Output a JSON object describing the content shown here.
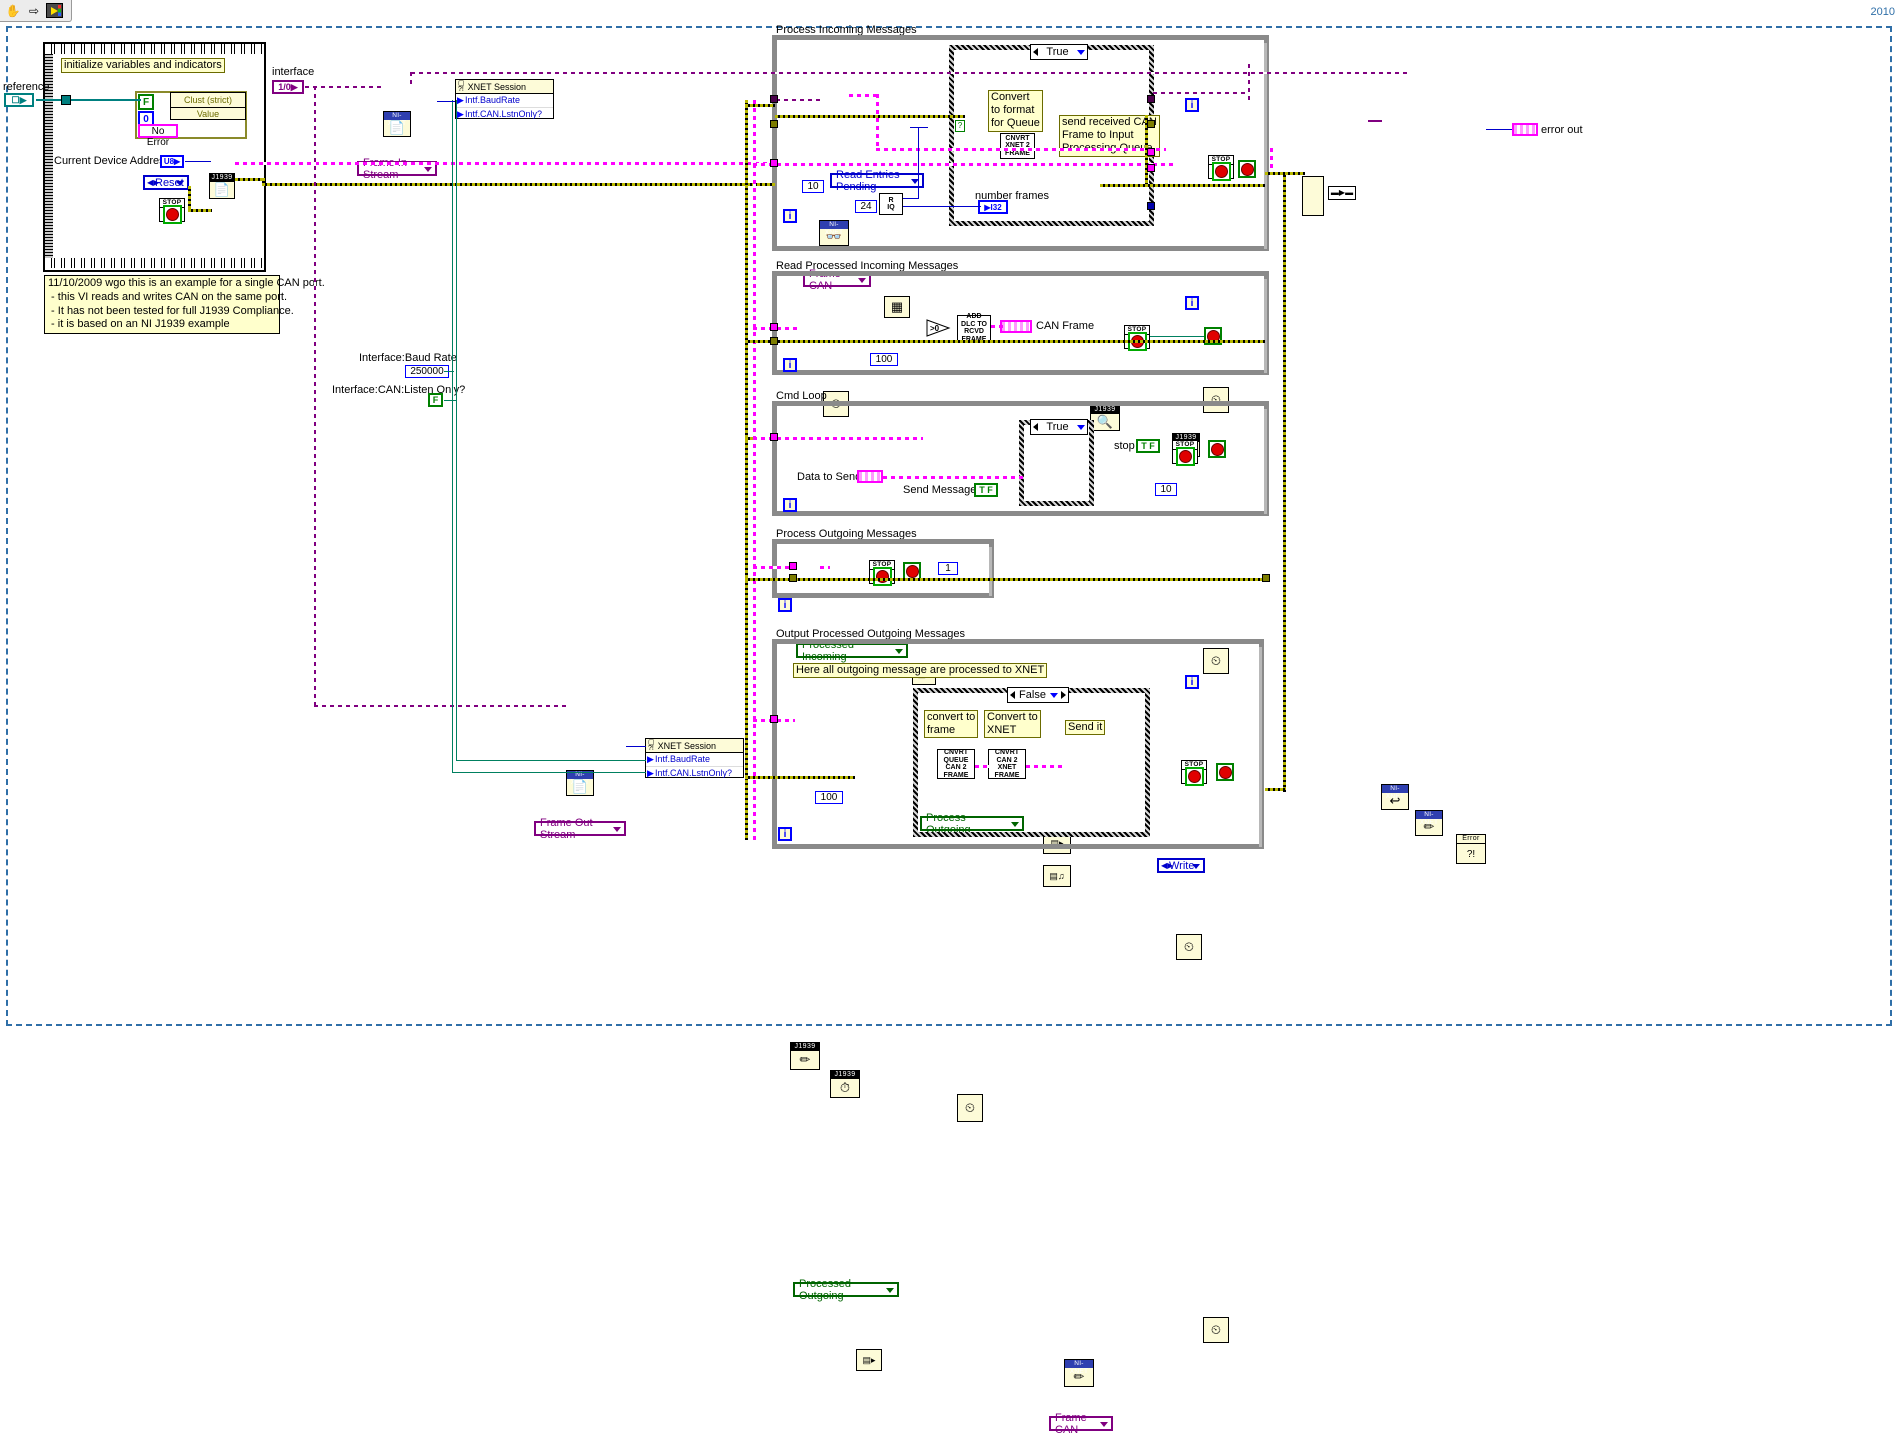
{
  "window": {
    "version_label": "2010",
    "toolbar": {
      "items": [
        {
          "name": "hand-tool-icon",
          "glyph": "✋"
        },
        {
          "name": "arrow-right-icon",
          "glyph": "⇨"
        },
        {
          "name": "run-vi-icon",
          "glyph": ""
        }
      ]
    }
  },
  "top_left": {
    "reference_label": "reference",
    "init_comment": "initialize variables and indicators",
    "cluster_vi": {
      "line1": "Clust (strict)",
      "line2": "Value"
    },
    "bool_f": "F",
    "number_zero": "0",
    "error_label": "No Error",
    "device_address_label": "Current Device Address",
    "device_address_type": "U8",
    "reset_enum": "Reset",
    "stop_label": "STOP",
    "j1939_label": "J1939",
    "note_comment": "11/10/2009 wgo this is an example for a single CAN port.\n - this VI reads and writes CAN on the same port.\n - It has not been tested for full J1939 Compliance.\n - it is based on an NI J1939 example"
  },
  "interface_section": {
    "interface_label": "interface",
    "interface_value": "1/0",
    "frame_in_stream": "Frame In Stream",
    "frame_out_stream": "Frame Out Stream",
    "nixnet_tag": "NI-XNET",
    "xnet_session_in": {
      "title": "XNET Session",
      "props": [
        "Intf.BaudRate",
        "Intf.CAN.LstnOnly?"
      ]
    },
    "xnet_session_out": {
      "title": "XNET Session",
      "props": [
        "Intf.BaudRate",
        "Intf.CAN.LstnOnly?"
      ]
    },
    "baud_rate_label": "Interface:Baud Rate",
    "baud_rate_value": "250000",
    "listen_only_label": "Interface:CAN:Listen Only?",
    "listen_only_value": "F"
  },
  "sections": [
    {
      "id": "process-incoming-messages",
      "title": "Process Incoming Messages",
      "read_entries_enum": "Read Entries Pending",
      "frame_can_enum": "Frame CAN",
      "nixnet_tag": "NI-XNET",
      "case_value": "True",
      "comment_convert": "Convert\nto format\nfor Queue",
      "comment_send": "send received CAN\nFrame to Input\nProcessing Queue",
      "cnvrt_vi": "CNVRT\nXNET 2\nFRAME",
      "number_frames_label": "number frames",
      "number_frames_type": "I32",
      "wait_value": "10",
      "divisor_value": "24",
      "greater_than": ">0",
      "loop_index": "i",
      "stop_label": "STOP",
      "j1939_tag": "J1939",
      "quotient_vi": "R\nIQ"
    },
    {
      "id": "read-processed-incoming-messages",
      "title": "Read Processed Incoming Messages",
      "queue_name": "Processed Incoming",
      "timeout_value": "100",
      "add_dlc_vi": "ADD\nDLC TO\nRCVD\nFRAME",
      "can_frame_label": "CAN Frame",
      "stop_label": "STOP",
      "loop_index": "i"
    },
    {
      "id": "cmd-loop",
      "title": "Cmd Loop",
      "queue_name": "Process Outgoing",
      "case_value": "True",
      "write_enum": "Write",
      "stop_label": "STOP",
      "stop_text": "stop",
      "stop_tf": "T F",
      "data_to_send_label": "Data to Send",
      "send_message_label": "Send Message?",
      "send_message_tf": "T F",
      "wait_value": "10",
      "loop_index": "i"
    },
    {
      "id": "process-outgoing-messages",
      "title": "Process Outgoing Messages",
      "j1939_tag": "J1939",
      "stop_label": "STOP",
      "wait_value": "1",
      "loop_index": "i"
    },
    {
      "id": "output-processed-outgoing-messages",
      "title": "Output Processed Outgoing Messages",
      "header_comment": "Here all outgoing message are processed to XNET",
      "queue_name": "Processed Outgoing",
      "timeout_value": "100",
      "case_value": "False",
      "comment_convert_frame": "convert to\nframe",
      "comment_convert_xnet": "Convert to\nXNET",
      "comment_send_it": "Send it",
      "cnvrt_queue_vi": "CNVRT\nQUEUE\nCAN 2\nFRAME",
      "cnvrt_can_vi": "CNVRT\nCAN 2\nXNET\nFRAME",
      "nixnet_tag": "NI-XNET",
      "frame_can_enum": "Frame CAN",
      "stop_label": "STOP",
      "loop_index": "i"
    }
  ],
  "right_side": {
    "nixnet_tag_1": "NI-XNET",
    "nixnet_tag_2": "NI-XNET",
    "error_vi": "Error\n?!",
    "error_out_label": "error out"
  }
}
